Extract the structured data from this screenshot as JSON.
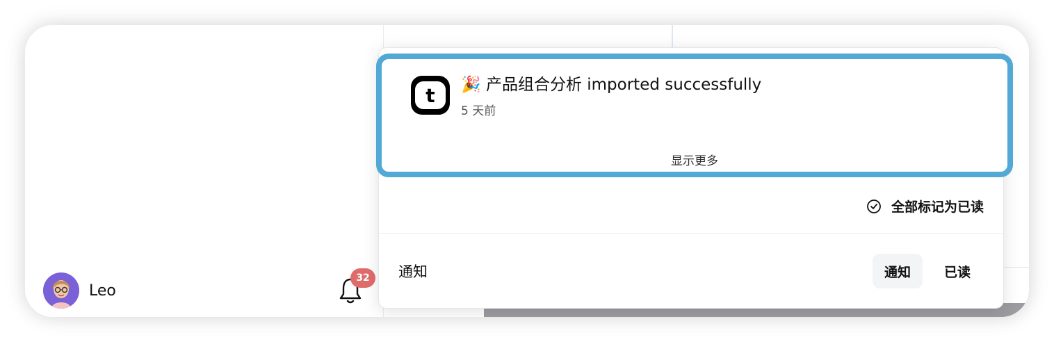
{
  "user": {
    "name": "Leo"
  },
  "notifications": {
    "badge_count": "32",
    "items": [
      {
        "emoji": "🎉",
        "title": "🎉 产品组合分析  imported successfully",
        "time": "5 天前",
        "logo_letter": "t"
      }
    ],
    "show_more": "显示更多",
    "mark_all_read": "全部标记为已读",
    "footer_title": "通知",
    "tabs": [
      {
        "label": "通知",
        "active": true
      },
      {
        "label": "已读",
        "active": false
      }
    ]
  },
  "colors": {
    "highlight": "#52a9d6",
    "badge": "#e06b6b",
    "avatar_bg": "#7b61d8"
  },
  "icons": {
    "bell": "bell-icon",
    "check": "check-circle-icon"
  }
}
